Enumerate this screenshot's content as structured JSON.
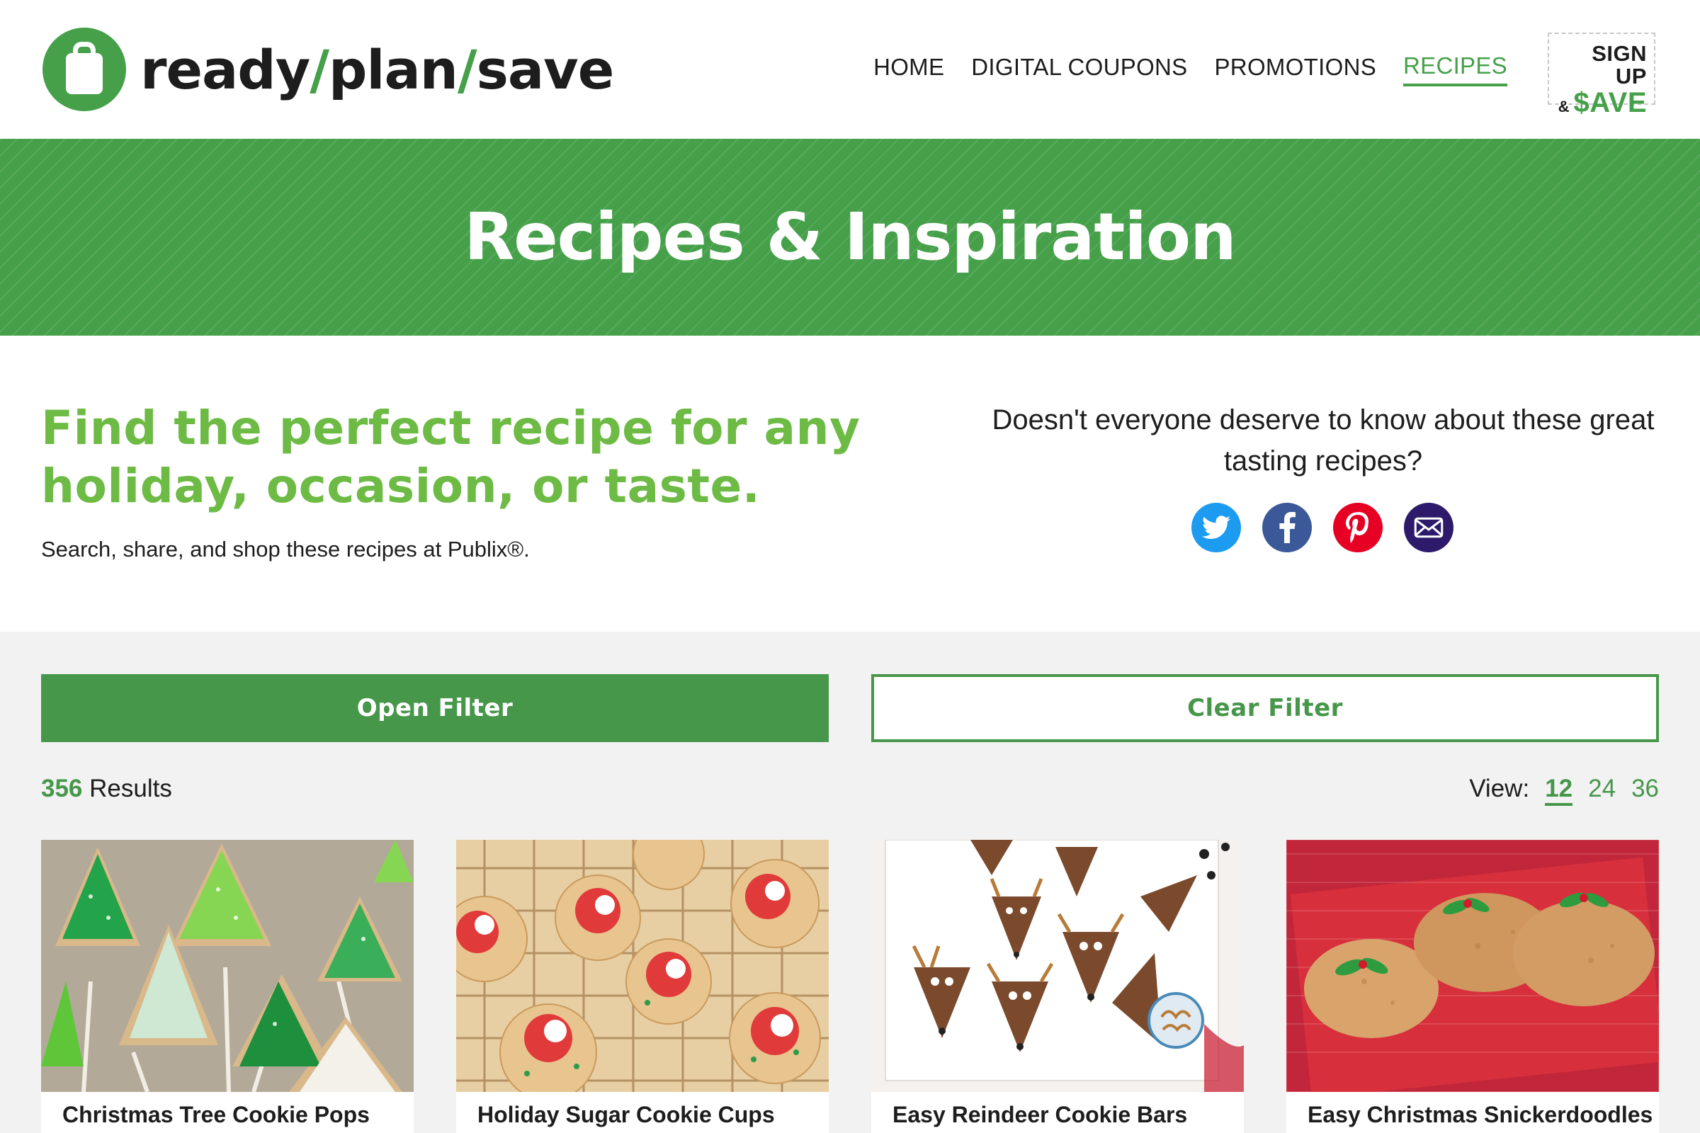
{
  "header": {
    "logo": {
      "part1": "ready",
      "slash": "/",
      "part2": "plan",
      "part3": "save"
    },
    "nav": [
      {
        "label": "HOME",
        "active": false
      },
      {
        "label": "DIGITAL COUPONS",
        "active": false
      },
      {
        "label": "PROMOTIONS",
        "active": false
      },
      {
        "label": "RECIPES",
        "active": true
      }
    ],
    "signup": {
      "top": "SIGN UP",
      "amp": "&",
      "save": "$AVE"
    }
  },
  "banner": {
    "title": "Recipes & Inspiration"
  },
  "intro": {
    "headline": "Find the perfect recipe for any holiday, occasion, or taste.",
    "subtext": "Search, share, and shop these recipes at Publix®.",
    "share_question": "Doesn't everyone deserve to know about these great tasting recipes?",
    "share_icons": [
      "twitter-icon",
      "facebook-icon",
      "pinterest-icon",
      "email-icon"
    ]
  },
  "filters": {
    "open_label": "Open Filter",
    "clear_label": "Clear Filter"
  },
  "results": {
    "count": "356",
    "count_label": "Results",
    "view_label": "View:",
    "view_options": [
      "12",
      "24",
      "36"
    ],
    "view_selected": "12"
  },
  "cards": [
    {
      "title": "Christmas Tree Cookie Pops"
    },
    {
      "title": "Holiday Sugar Cookie Cups"
    },
    {
      "title": "Easy Reindeer Cookie Bars"
    },
    {
      "title": "Easy Christmas Snickerdoodles"
    }
  ],
  "colors": {
    "brand_green": "#46a04a",
    "accent_green": "#6dbb45",
    "text_dark": "#1d1d1d"
  }
}
